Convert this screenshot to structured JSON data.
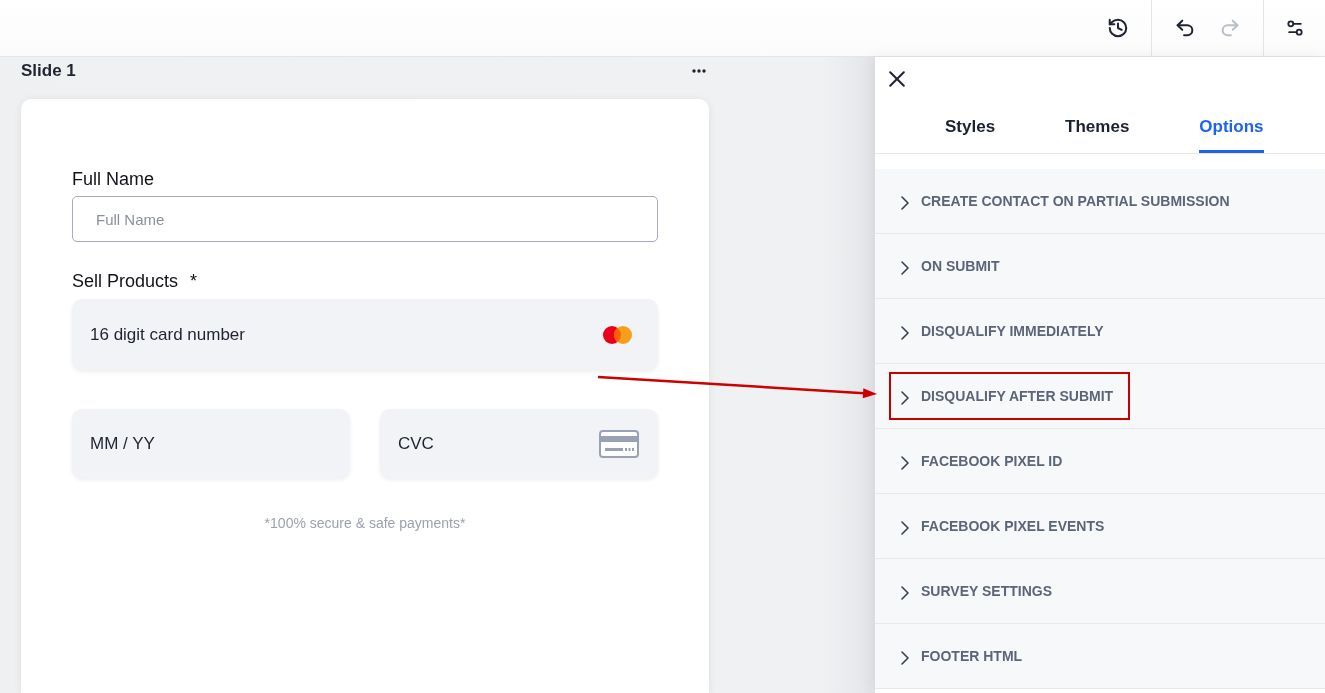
{
  "toolbar": {
    "groups": [
      {
        "buttons": [
          {
            "kind": "history",
            "disabled": false
          }
        ]
      },
      {
        "buttons": [
          {
            "kind": "undo",
            "disabled": false
          },
          {
            "kind": "redo",
            "disabled": true
          }
        ]
      },
      {
        "buttons": [
          {
            "kind": "settings",
            "disabled": false
          }
        ]
      }
    ]
  },
  "slide": {
    "title": "Slide 1",
    "form": {
      "full_name": {
        "label": "Full Name",
        "placeholder": "Full Name"
      },
      "payment": {
        "label": "Sell Products",
        "required_mark": "*",
        "card_number": {
          "placeholder": "16 digit card number"
        },
        "expiry": {
          "placeholder": "MM / YY"
        },
        "cvc": {
          "placeholder": "CVC"
        },
        "note": "*100% secure & safe payments*"
      }
    }
  },
  "panel": {
    "tabs": [
      {
        "label": "Styles",
        "selected": false
      },
      {
        "label": "Themes",
        "selected": false
      },
      {
        "label": "Options",
        "selected": true
      }
    ],
    "sections": [
      {
        "label": "CREATE CONTACT ON PARTIAL SUBMISSION",
        "expanded": false,
        "highlighted": false
      },
      {
        "label": "ON SUBMIT",
        "expanded": false,
        "highlighted": false
      },
      {
        "label": "DISQUALIFY IMMEDIATELY",
        "expanded": false,
        "highlighted": false
      },
      {
        "label": "DISQUALIFY AFTER SUBMIT",
        "expanded": false,
        "highlighted": true
      },
      {
        "label": "FACEBOOK PIXEL ID",
        "expanded": false,
        "highlighted": false
      },
      {
        "label": "FACEBOOK PIXEL EVENTS",
        "expanded": false,
        "highlighted": false
      },
      {
        "label": "SURVEY SETTINGS",
        "expanded": false,
        "highlighted": false
      },
      {
        "label": "FOOTER HTML",
        "expanded": false,
        "highlighted": false
      }
    ]
  }
}
